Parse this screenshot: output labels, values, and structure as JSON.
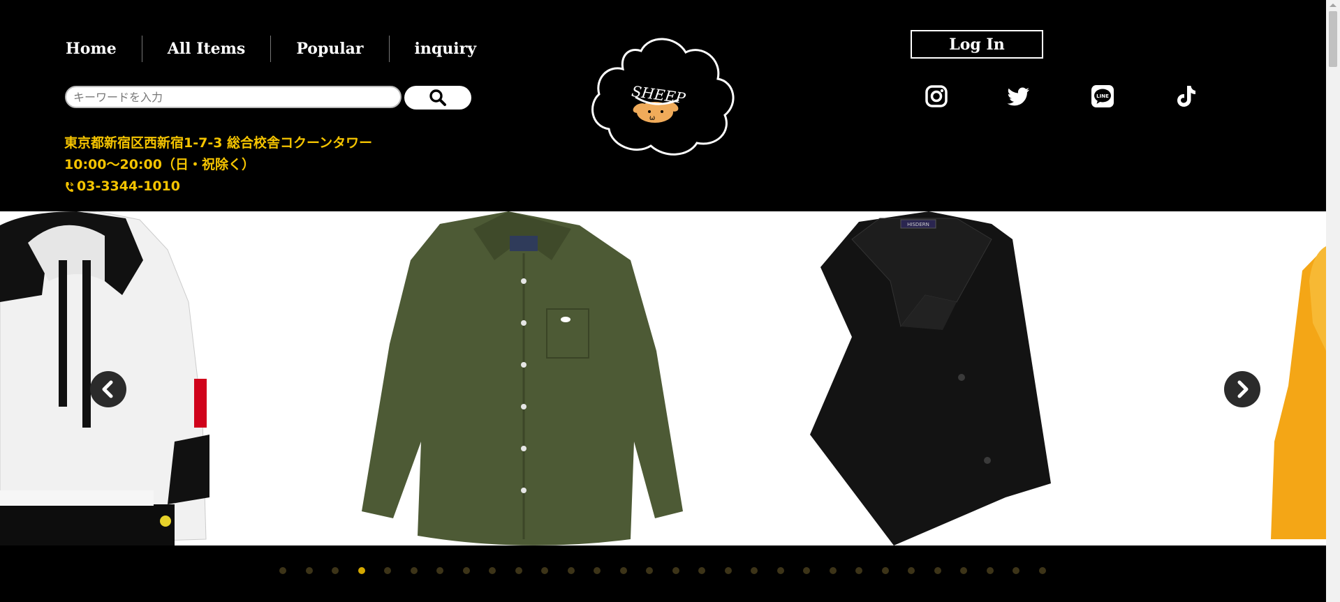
{
  "nav": {
    "items": [
      {
        "label": "Home"
      },
      {
        "label": "All Items"
      },
      {
        "label": "Popular"
      },
      {
        "label": "inquiry"
      }
    ]
  },
  "search": {
    "placeholder": "キーワードを入力",
    "value": ""
  },
  "shop": {
    "address": "東京都新宿区西新宿1-7-3 総合校舎コクーンタワー",
    "hours": "10:00〜20:00（日・祝除く）",
    "phone": "03-3344-1010"
  },
  "logo": {
    "text": "SHEEP",
    "face_text": "ω"
  },
  "account": {
    "login_label": "Log In"
  },
  "social": [
    "instagram-icon",
    "twitter-icon",
    "line-icon",
    "tiktok-icon"
  ],
  "social_line_text": "LINE",
  "carousel": {
    "slides": [
      "white-black-hoodie",
      "olive-green-shirt",
      "black-dress-shirt",
      "yellow-hoodie"
    ],
    "shirt_brand_tag": "HISDERN",
    "dot_count": 30,
    "active_index": 3
  },
  "colors": {
    "background": "#000000",
    "accent": "#f5c400",
    "text": "#ffffff"
  }
}
